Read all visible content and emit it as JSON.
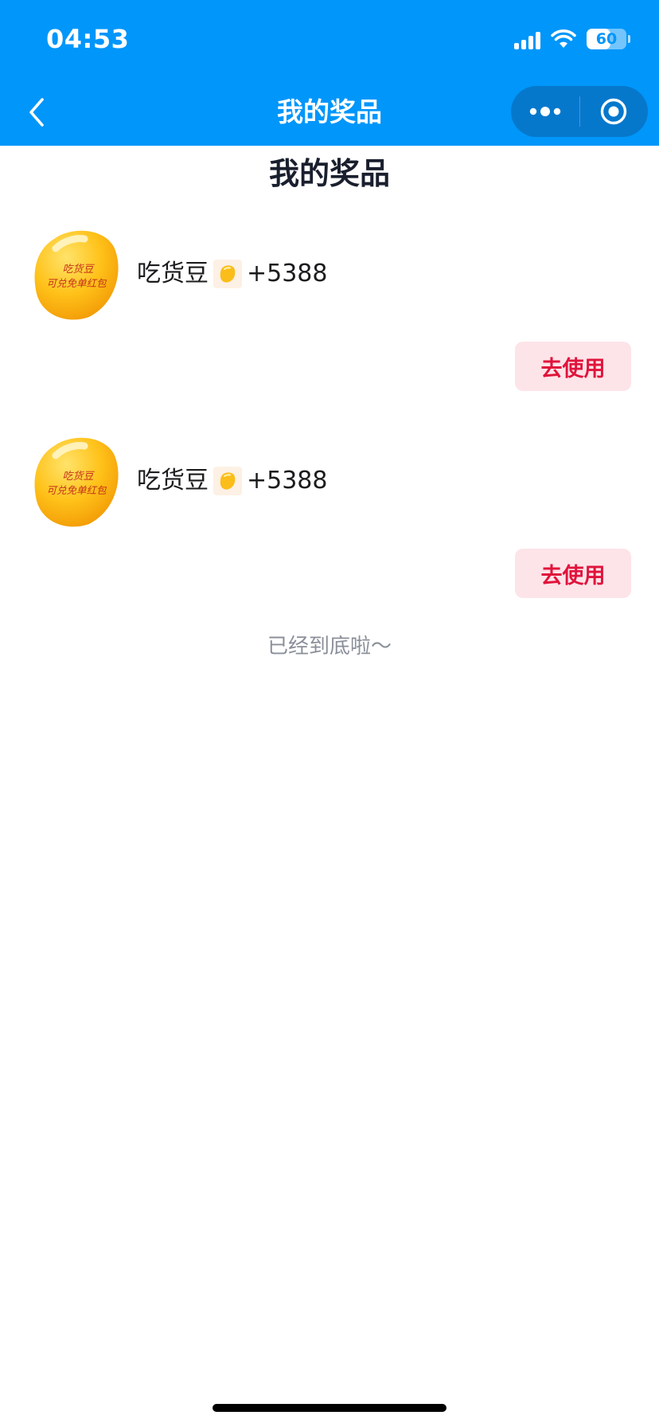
{
  "status_bar": {
    "time": "04:53",
    "battery": "60",
    "battery_level": 0.6,
    "icons": [
      "signal-icon",
      "wifi-icon",
      "battery-icon"
    ]
  },
  "nav": {
    "title": "我的奖品",
    "back_icon": "chevron-left-icon",
    "more_icon": "more-dots-icon",
    "close_icon": "target-circle-icon"
  },
  "page": {
    "heading": "我的奖品",
    "end_text": "已经到底啦～"
  },
  "prizes": [
    {
      "name": "吃货豆",
      "amount": "+5388",
      "thumb_line1": "吃货豆",
      "thumb_line2": "可兑免单红包",
      "button": "去使用"
    },
    {
      "name": "吃货豆",
      "amount": "+5388",
      "thumb_line1": "吃货豆",
      "thumb_line2": "可兑免单红包",
      "button": "去使用"
    }
  ],
  "colors": {
    "header": "#0096fa",
    "button_bg": "#fde4e9",
    "button_text": "#e0143c",
    "bean": "#fbbd1a"
  }
}
